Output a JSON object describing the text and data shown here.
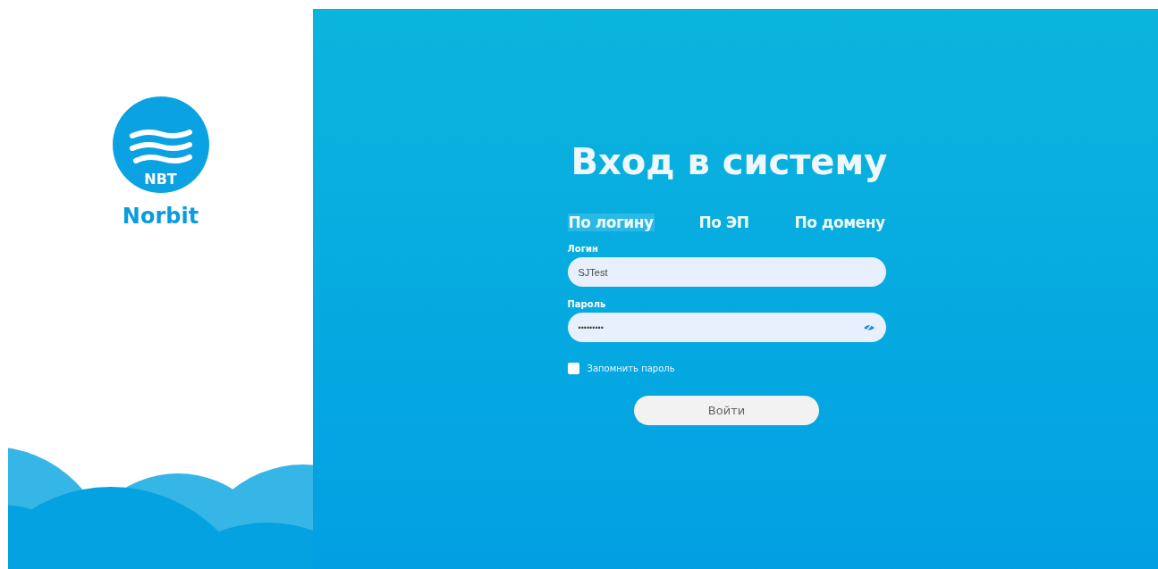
{
  "brand": {
    "badge": "NBT",
    "name": "Norbit"
  },
  "title": "Вход в систему",
  "tabs": [
    {
      "label": "По логину",
      "selected": true
    },
    {
      "label": "По ЭП",
      "selected": false
    },
    {
      "label": "По домену",
      "selected": false
    }
  ],
  "fields": [
    {
      "label": "Логин",
      "value": "SJTest",
      "kind": "text"
    },
    {
      "label": "Пароль",
      "value": "•••••••••",
      "kind": "password"
    }
  ],
  "remember": {
    "label": "Запомнить пароль",
    "checked": false
  },
  "submit": "Войти"
}
